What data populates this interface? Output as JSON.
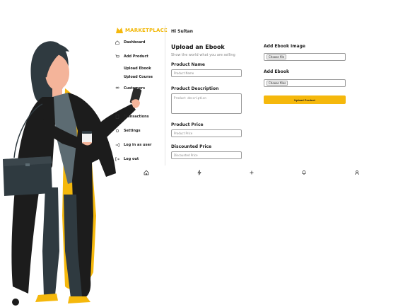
{
  "app": {
    "logo_text": "MARKETPLACE",
    "brand_color": "#f5b80c"
  },
  "sidebar": {
    "items": [
      {
        "label": "Dashboard",
        "icon": "home-icon"
      },
      {
        "label": "Add Product",
        "icon": "cart-icon"
      },
      {
        "label": "Customers",
        "icon": "users-icon"
      },
      {
        "label": "Transactions",
        "icon": "receipt-icon"
      },
      {
        "label": "Settings",
        "icon": "gear-icon"
      },
      {
        "label": "Log in as user",
        "icon": "login-icon"
      },
      {
        "label": "Log out",
        "icon": "logout-icon"
      }
    ],
    "sub_items": [
      "Upload Ebook",
      "Upload Course"
    ]
  },
  "header": {
    "greeting": "Hi Sultan"
  },
  "form": {
    "title": "Upload an Ebook",
    "subtitle": "Show the world what you are selling",
    "product_name_label": "Product Name",
    "product_name_placeholder": "Product Name",
    "product_description_label": "Product Description",
    "product_description_placeholder": "Product description",
    "product_price_label": "Product Price",
    "product_price_placeholder": "Product Price",
    "discounted_price_label": "Discounted Price",
    "discounted_price_placeholder": "Discounted Price",
    "ebook_image_label": "Add Ebook Image",
    "ebook_label": "Add Ebook",
    "choose_file_label": "Choose file",
    "choose_files_label": "Choose files",
    "upload_button": "Upload Product"
  },
  "bottom_nav": {
    "icons": [
      "home-icon",
      "lightning-icon",
      "plus-icon",
      "bell-icon",
      "user-icon"
    ]
  }
}
